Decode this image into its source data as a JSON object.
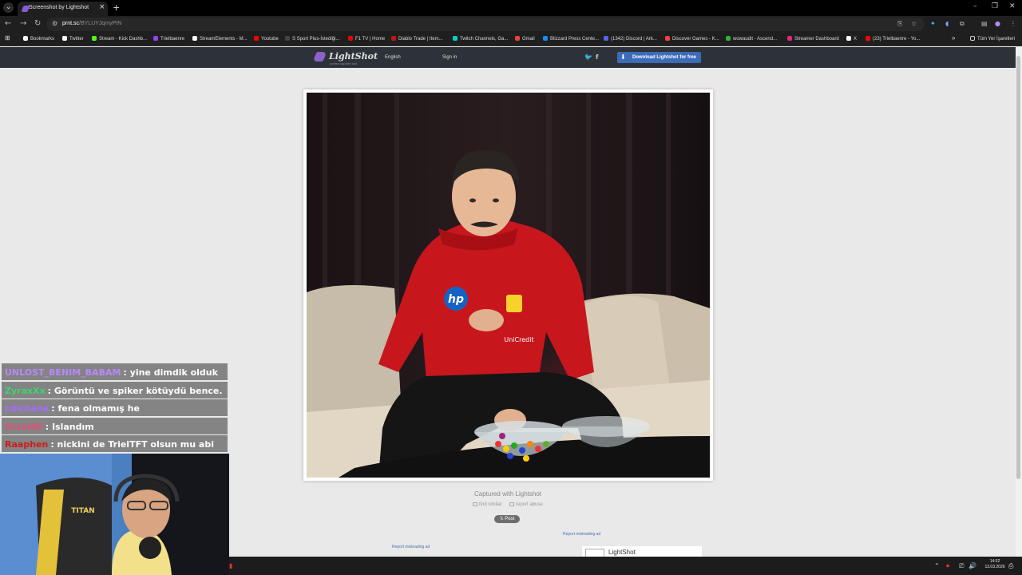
{
  "browser": {
    "tab_title": "Screenshot by Lightshot",
    "url_host": "prnt.sc",
    "url_path": "/BYLUYJqmyPtN",
    "bookmarks": [
      {
        "label": "Bookmarks",
        "color": "#ffffff"
      },
      {
        "label": "Twitter",
        "color": "#ffffff"
      },
      {
        "label": "Stream - Kick Dashb...",
        "color": "#53fc18"
      },
      {
        "label": "Trielbaenre",
        "color": "#9146ff"
      },
      {
        "label": "StreamElements - M...",
        "color": "#ffffff"
      },
      {
        "label": "Youtube",
        "color": "#ff0000"
      },
      {
        "label": "S Sport Plus-İstediği...",
        "color": "#444444"
      },
      {
        "label": "F1 TV | Home",
        "color": "#e10600"
      },
      {
        "label": "Diablo Trade | Item...",
        "color": "#c2161b"
      },
      {
        "label": "Twitch Channels, Ga...",
        "color": "#00d0c0"
      },
      {
        "label": "Gmail",
        "color": "#ea4335"
      },
      {
        "label": "Blizzard Press Cente...",
        "color": "#148eff"
      },
      {
        "label": "(1342) Discord | Ark...",
        "color": "#5865f2"
      },
      {
        "label": "Discover Games - K...",
        "color": "#ff4040"
      },
      {
        "label": "wowaudit - Ascend...",
        "color": "#30b040"
      },
      {
        "label": "Streamer Dashboard",
        "color": "#e0287c"
      },
      {
        "label": "X",
        "color": "#ffffff"
      },
      {
        "label": "(23) Trielbaenre - Yo...",
        "color": "#ff0000"
      }
    ],
    "all_bookmarks": "Tüm Yer İşaretleri"
  },
  "lightshot": {
    "logo": "LightShot",
    "tagline": "screen capture tool",
    "language": "English",
    "signin": "Sign in",
    "download_label": "Download Lightshot for free",
    "captured": "Captured with Lightshot",
    "find_similar": "find similar",
    "report_abuse": "report abuse",
    "post_label": "Post",
    "report_ad_1": "Report misleading ad",
    "report_ad_2": "Report misleading ad",
    "ad_text": "LightShot"
  },
  "chat": [
    {
      "user": "UNLOST_BENIM_BABAM",
      "message": ": yine dimdik olduk",
      "color": "#b889ff"
    },
    {
      "user": "ZyraxXx",
      "message": ": Görüntü ve spiker kötüydü bence.",
      "color": "#3cd66b"
    },
    {
      "user": "cdicbaba",
      "message": ": fena olmamış he",
      "color": "#a66bff"
    },
    {
      "user": "Orzel00",
      "message": ": Islandım",
      "color": "#e0507a"
    },
    {
      "user": "Raaphen",
      "message": ": nickini de TrielTFT olsun mu abi",
      "color": "#d11a1a"
    }
  ],
  "webcam": {
    "chair_brand": "TITAN"
  },
  "taskbar": {
    "time": "14:32",
    "date": "13.03.2026"
  },
  "photo": {
    "jacket_color": "#c8161d",
    "logo_hp": "hp",
    "logo_unicredit": "UniCredit"
  }
}
